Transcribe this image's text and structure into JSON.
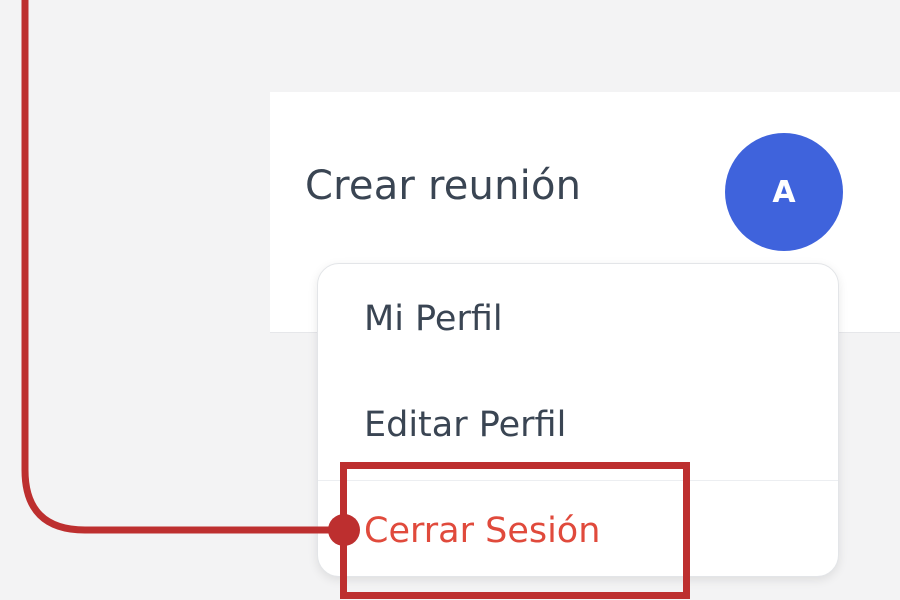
{
  "header": {
    "create_meeting_label": "Crear reunión",
    "avatar_initial": "A"
  },
  "user_menu": {
    "items": [
      {
        "label": "Mi Perfil"
      },
      {
        "label": "Editar Perfil"
      },
      {
        "label": "Cerrar Sesión"
      }
    ]
  },
  "colors": {
    "page_background": "#f3f3f4",
    "panel_background": "#ffffff",
    "text": "#3a4553",
    "avatar": "#3f63dc",
    "logout_text": "#e04a3c",
    "annotation": "#bd2f2f"
  }
}
